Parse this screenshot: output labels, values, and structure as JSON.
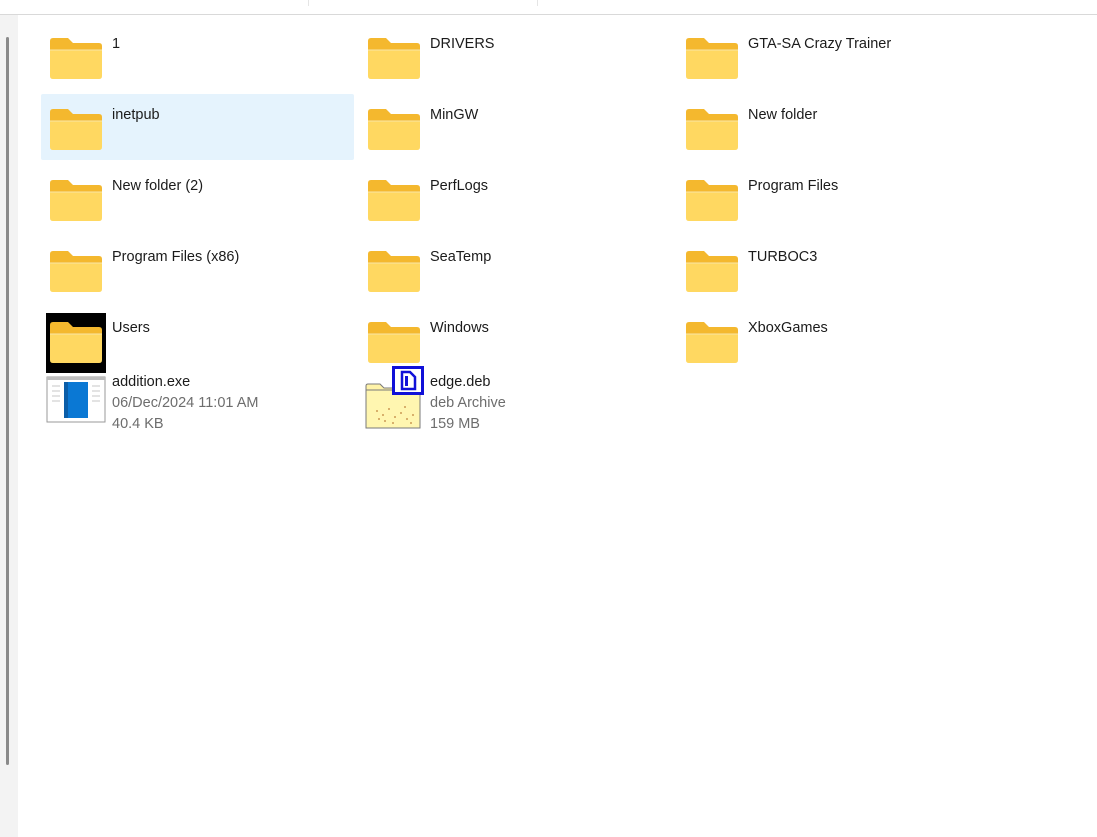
{
  "items": [
    {
      "name": "1",
      "type": "folder",
      "variant": "doc"
    },
    {
      "name": "DRIVERS",
      "type": "folder",
      "variant": "plain"
    },
    {
      "name": "GTA-SA Crazy Trainer",
      "type": "folder",
      "variant": "doc"
    },
    {
      "name": "inetpub",
      "type": "folder",
      "variant": "plain",
      "selected": true
    },
    {
      "name": "MinGW",
      "type": "folder",
      "variant": "plain"
    },
    {
      "name": "New folder",
      "type": "folder",
      "variant": "doc"
    },
    {
      "name": "New folder (2)",
      "type": "folder",
      "variant": "plain"
    },
    {
      "name": "PerfLogs",
      "type": "folder",
      "variant": "plain"
    },
    {
      "name": "Program Files",
      "type": "folder",
      "variant": "plain"
    },
    {
      "name": "Program Files (x86)",
      "type": "folder",
      "variant": "plain"
    },
    {
      "name": "SeaTemp",
      "type": "folder",
      "variant": "plain"
    },
    {
      "name": "TURBOC3",
      "type": "folder",
      "variant": "doc"
    },
    {
      "name": "Users",
      "type": "folder",
      "variant": "dark"
    },
    {
      "name": "Windows",
      "type": "folder",
      "variant": "doc"
    },
    {
      "name": "XboxGames",
      "type": "folder",
      "variant": "plain"
    },
    {
      "name": "addition.exe",
      "type": "exe",
      "detail1": "06/Dec/2024 11:01 AM",
      "detail2": "40.4 KB"
    },
    {
      "name": "edge.deb",
      "type": "archive",
      "detail1": "deb Archive",
      "detail2": "159 MB"
    }
  ],
  "colors": {
    "folder_back": "#f4b82e",
    "folder_front": "#ffd861",
    "selection": "#e5f3fd",
    "highlight_box": "#1010d8"
  }
}
